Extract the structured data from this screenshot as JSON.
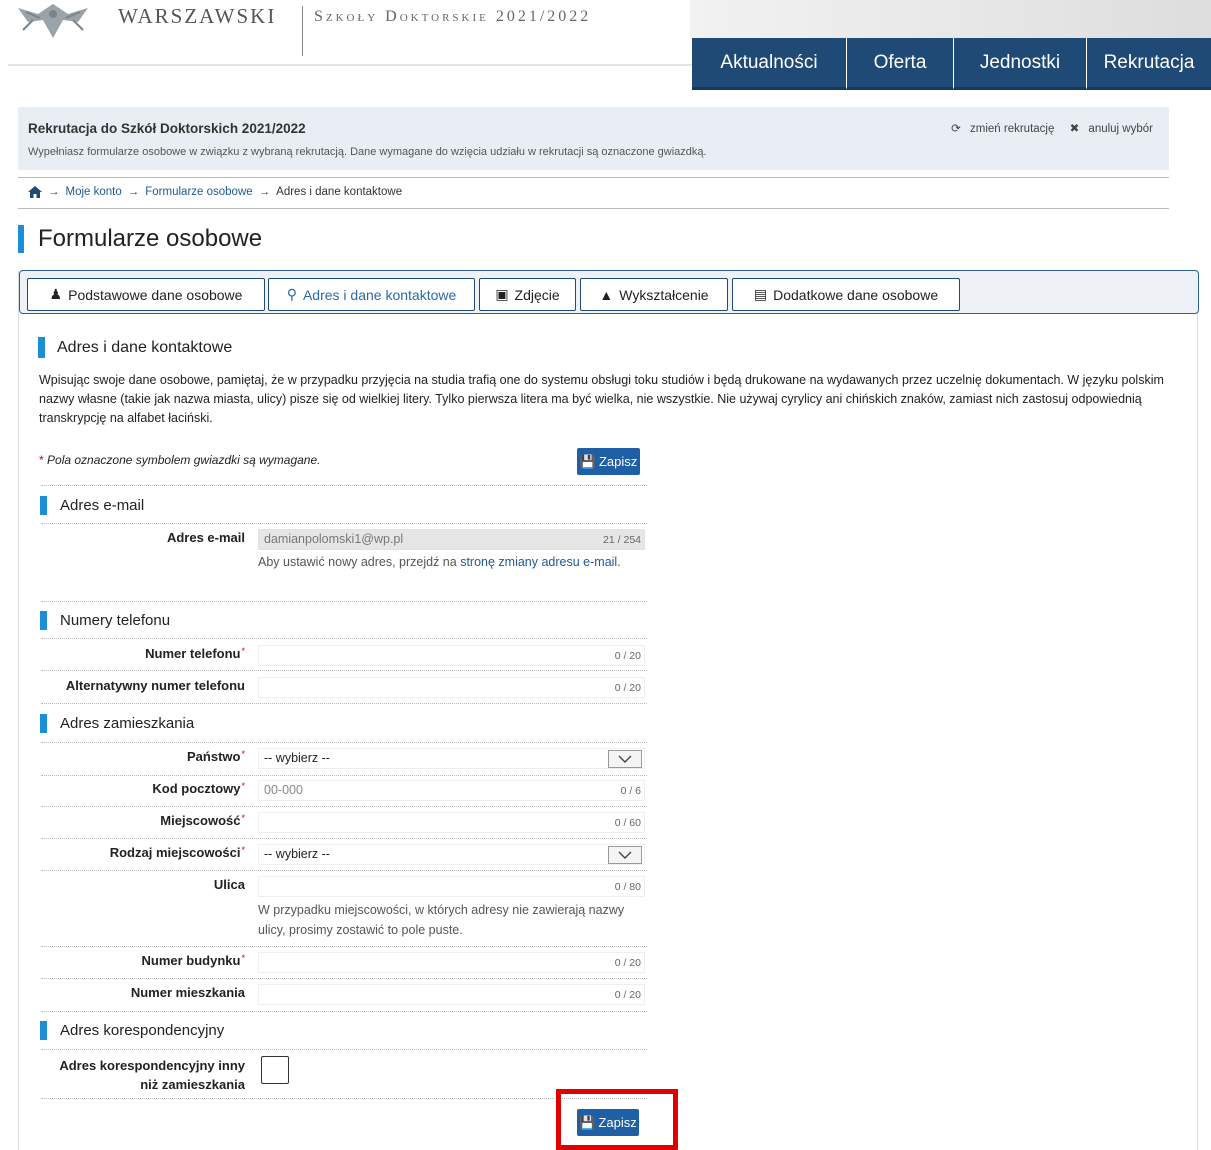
{
  "header": {
    "logo_word": "WARSZAWSKI",
    "logo_sub": "Szkoły Doktorskie 2021/2022",
    "nav": [
      "Aktualności",
      "Oferta",
      "Jednostki",
      "Rekrutacja"
    ]
  },
  "info": {
    "title": "Rekrutacja do Szkół Doktorskich 2021/2022",
    "desc": "Wypełniasz formularze osobowe w związku z wybraną rekrutacją. Dane wymagane do wzięcia udziału w rekrutacji są oznaczone gwiazdką.",
    "change": "zmień rekrutację",
    "cancel": "anuluj wybór"
  },
  "breadcrumb": {
    "account": "Moje konto",
    "forms": "Formularze osobowe",
    "current": "Adres i dane kontaktowe"
  },
  "page_title": "Formularze osobowe",
  "tabs": [
    "Podstawowe dane osobowe",
    "Adres i dane kontaktowe",
    "Zdjęcie",
    "Wykształcenie",
    "Dodatkowe dane osobowe"
  ],
  "form": {
    "heading": "Adres i dane kontaktowe",
    "intro": "Wpisując swoje dane osobowe, pamiętaj, że w przypadku przyjęcia na studia trafią one do systemu obsługi toku studiów i będą drukowane na wydawanych przez uczelnię dokumentach. W języku polskim nazwy własne (takie jak nazwa miasta, ulicy) pisze się od wielkiej litery. Tylko pierwsza litera ma być wielka, nie wszystkie. Nie używaj cyrylicy ani chińskich znaków, zamiast nich zastosuj odpowiednią transkrypcję na alfabet łaciński.",
    "req_note": "Pola oznaczone symbolem gwiazdki są wymagane.",
    "save": "Zapisz",
    "email_section": "Adres e-mail",
    "email_label": "Adres e-mail",
    "email_value": "damianpolomski1@wp.pl",
    "email_count": "21 / 254",
    "email_help_prefix": "Aby ustawić nowy adres, przejdź na",
    "email_help_link": "stronę zmiany adresu e-mail",
    "phone_section": "Numery telefonu",
    "phone_label": "Numer telefonu",
    "phone_count": "0 / 20",
    "alt_phone_label": "Alternatywny numer telefonu",
    "alt_phone_count": "0 / 20",
    "address_section": "Adres zamieszkania",
    "country_label": "Państwo",
    "country_value": "-- wybierz --",
    "postal_label": "Kod pocztowy",
    "postal_placeholder": "00-000",
    "postal_count": "0 / 6",
    "city_label": "Miejscowość",
    "city_count": "0 / 60",
    "city_type_label": "Rodzaj miejscowości",
    "city_type_value": "-- wybierz --",
    "street_label": "Ulica",
    "street_count": "0 / 80",
    "street_help": "W przypadku miejscowości, w których adresy nie zawierają nazwy ulicy, prosimy zostawić to pole puste.",
    "building_label": "Numer budynku",
    "building_count": "0 / 20",
    "flat_label": "Numer mieszkania",
    "flat_count": "0 / 20",
    "corr_section": "Adres korespondencyjny",
    "corr_label": "Adres korespondencyjny inny niż zamieszkania"
  }
}
